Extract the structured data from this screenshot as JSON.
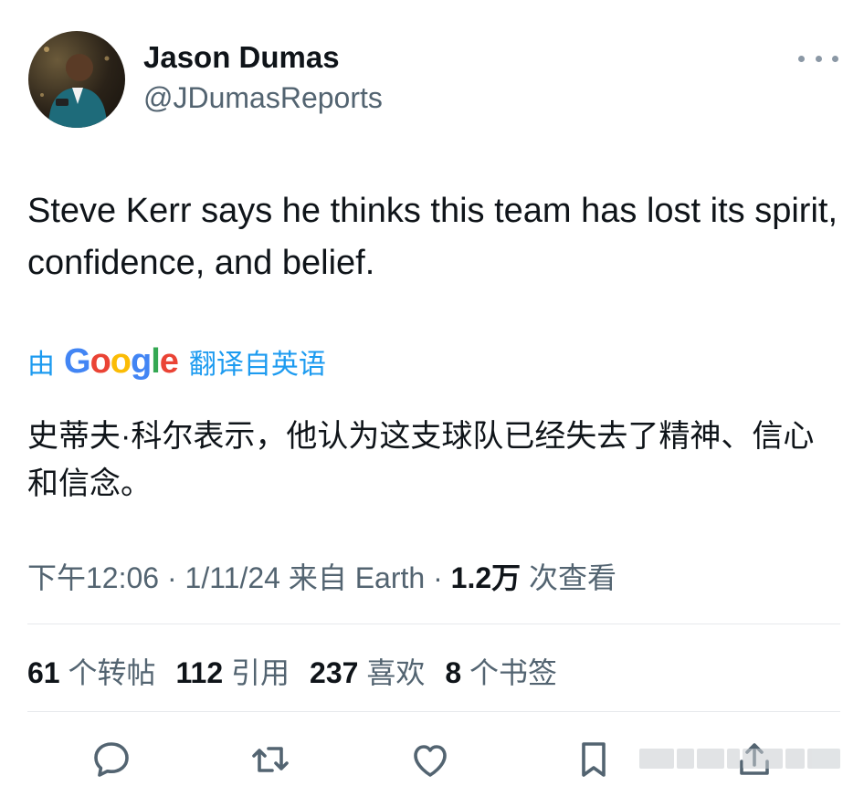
{
  "author": {
    "name": "Jason Dumas",
    "handle": "@JDumasReports"
  },
  "tweet": {
    "text": "Steve Kerr says he thinks this team has lost its spirit, confidence, and belief."
  },
  "translation": {
    "prefix": "由",
    "google_letters": [
      "G",
      "o",
      "o",
      "g",
      "l",
      "e"
    ],
    "suffix": "翻译自英语",
    "text": "史蒂夫·科尔表示，他认为这支球队已经失去了精神、信心和信念。"
  },
  "meta": {
    "time": "下午12:06",
    "sep1": " · ",
    "date": "1/11/24",
    "source": " 来自 Earth",
    "sep2": " · ",
    "views_count": "1.2万",
    "views_label": " 次查看"
  },
  "stats": {
    "retweets_count": "61",
    "retweets_label": " 个转帖",
    "quotes_count": "112",
    "quotes_label": " 引用",
    "likes_count": "237",
    "likes_label": " 喜欢",
    "bookmarks_count": "8",
    "bookmarks_label": " 个书签"
  },
  "icons": {
    "more": "more-horizontal-icon",
    "reply": "reply-icon",
    "retweet": "retweet-icon",
    "like": "heart-icon",
    "bookmark": "bookmark-icon",
    "share": "share-icon"
  },
  "colors": {
    "text": "#0f1419",
    "secondary": "#536471",
    "link": "#1d9bf0",
    "divider": "#e6e9ec"
  }
}
